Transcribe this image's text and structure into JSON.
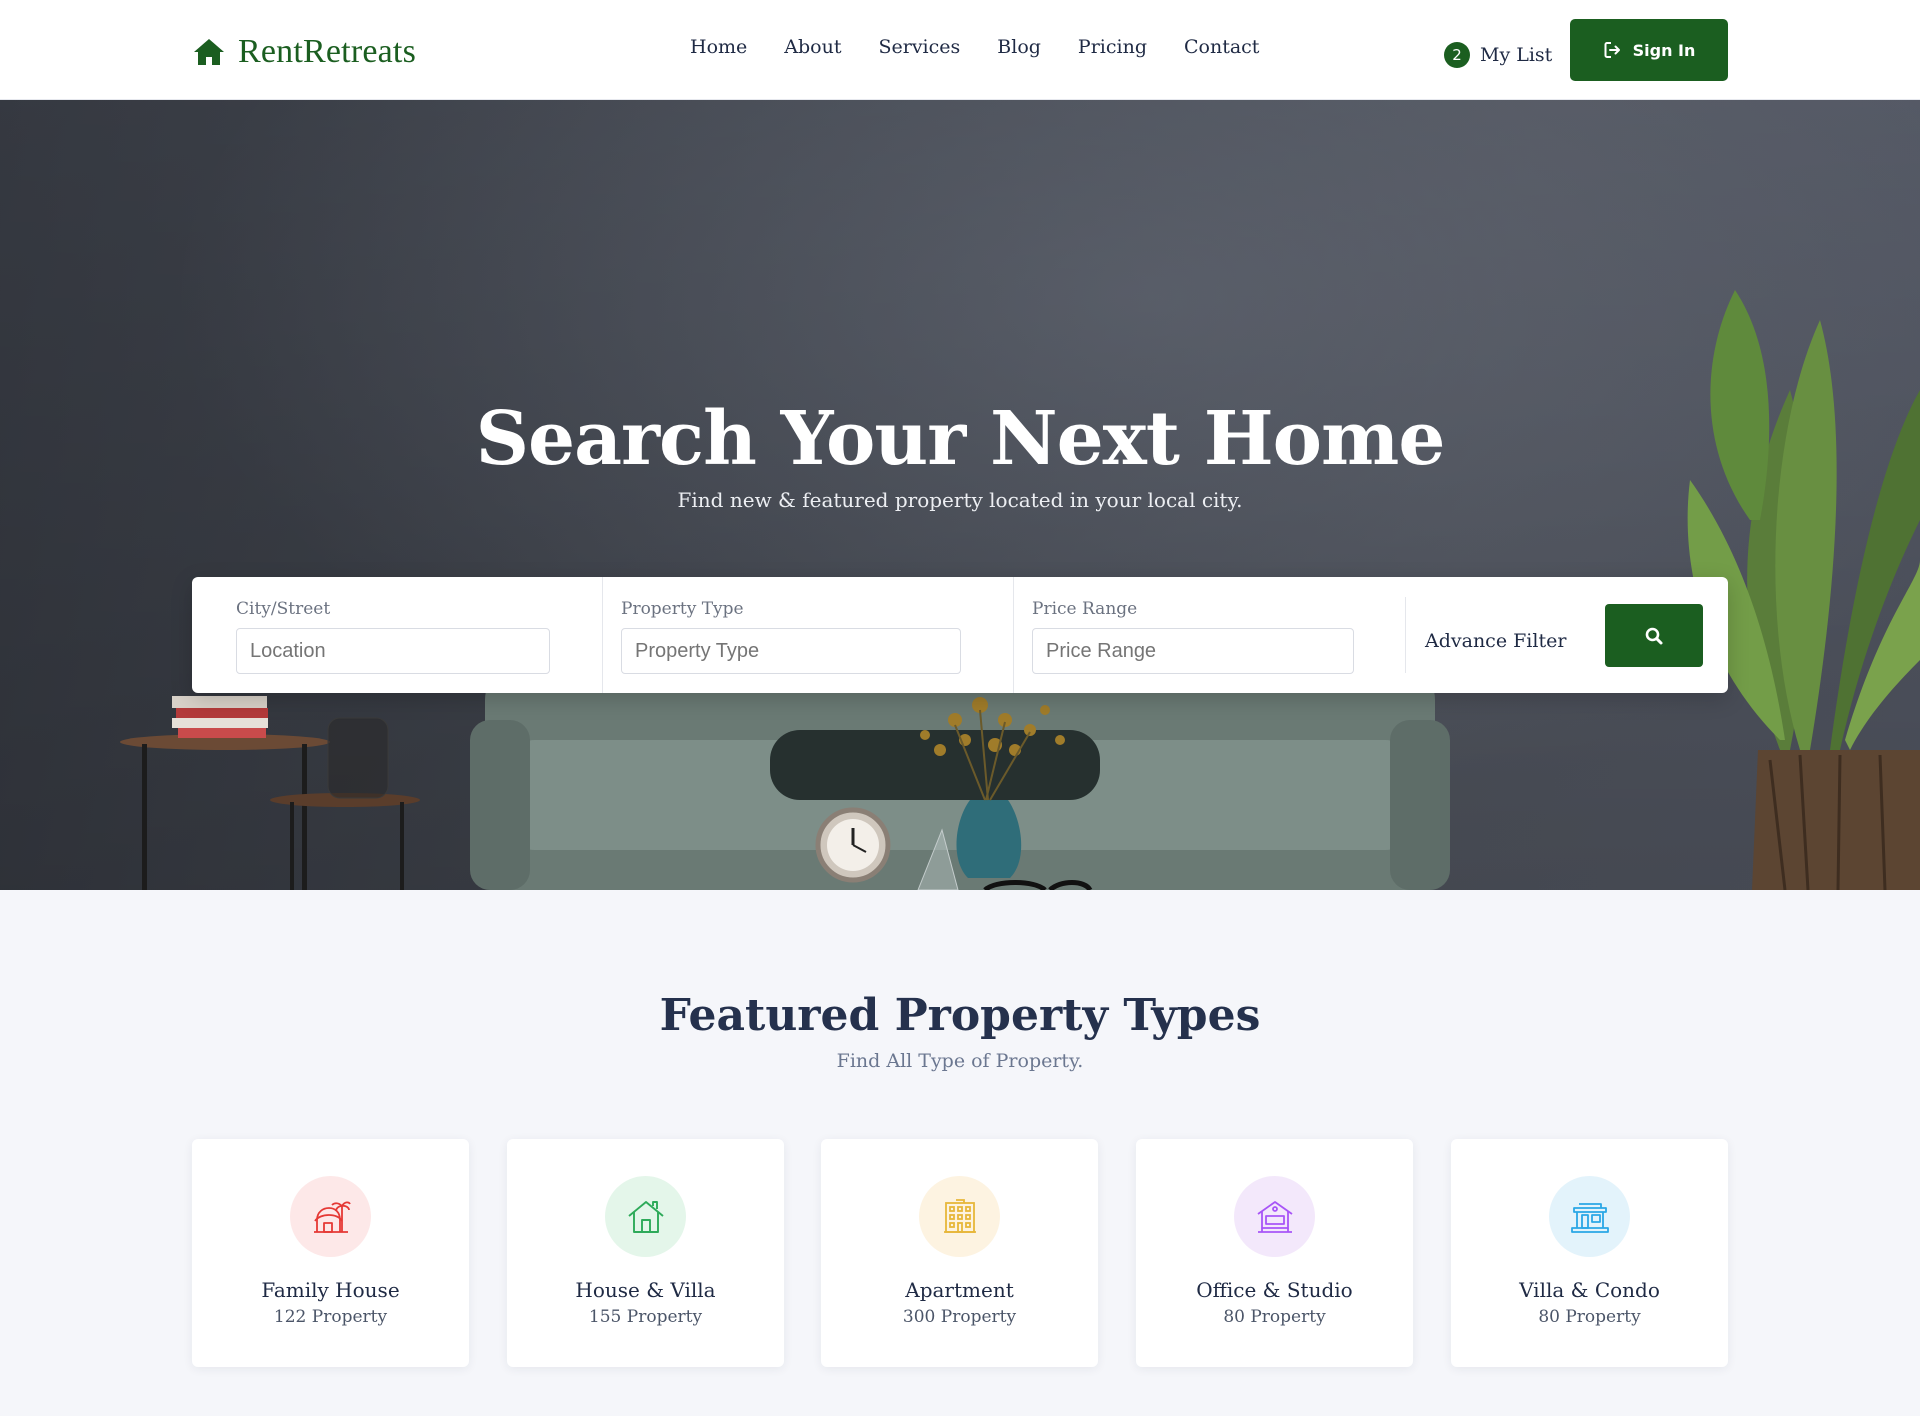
{
  "brand": {
    "name": "RentRetreats",
    "color": "#1b5e20",
    "icon": "home-icon"
  },
  "nav": [
    {
      "label": "Home"
    },
    {
      "label": "About"
    },
    {
      "label": "Services"
    },
    {
      "label": "Blog"
    },
    {
      "label": "Pricing"
    },
    {
      "label": "Contact"
    }
  ],
  "mylist": {
    "count": "2",
    "label": "My List"
  },
  "signin": {
    "label": "Sign In",
    "icon": "sign-in-icon"
  },
  "hero": {
    "title": "Search Your Next Home",
    "subtitle": "Find new & featured property located in your local city."
  },
  "search": {
    "city": {
      "label": "City/Street",
      "placeholder": "Location"
    },
    "type": {
      "label": "Property Type",
      "placeholder": "Property Type"
    },
    "price": {
      "label": "Price Range",
      "placeholder": "Price Range"
    },
    "advance_label": "Advance Filter",
    "button_icon": "search-icon"
  },
  "featured": {
    "title": "Featured Property Types",
    "subtitle": "Find All Type of Property.",
    "cards": [
      {
        "name": "Family House",
        "count": "122 Property",
        "icon": "family-house-icon",
        "color": "#e53935",
        "bg": "#fde8e8"
      },
      {
        "name": "House & Villa",
        "count": "155 Property",
        "icon": "house-villa-icon",
        "color": "#2eaa5a",
        "bg": "#e4f6ea"
      },
      {
        "name": "Apartment",
        "count": "300 Property",
        "icon": "apartment-icon",
        "color": "#e7b73a",
        "bg": "#fdf3e1"
      },
      {
        "name": "Office & Studio",
        "count": "80 Property",
        "icon": "office-studio-icon",
        "color": "#a855f7",
        "bg": "#f3e8fb"
      },
      {
        "name": "Villa & Condo",
        "count": "80 Property",
        "icon": "villa-condo-icon",
        "color": "#2aa7e6",
        "bg": "#e3f3fb"
      }
    ]
  }
}
